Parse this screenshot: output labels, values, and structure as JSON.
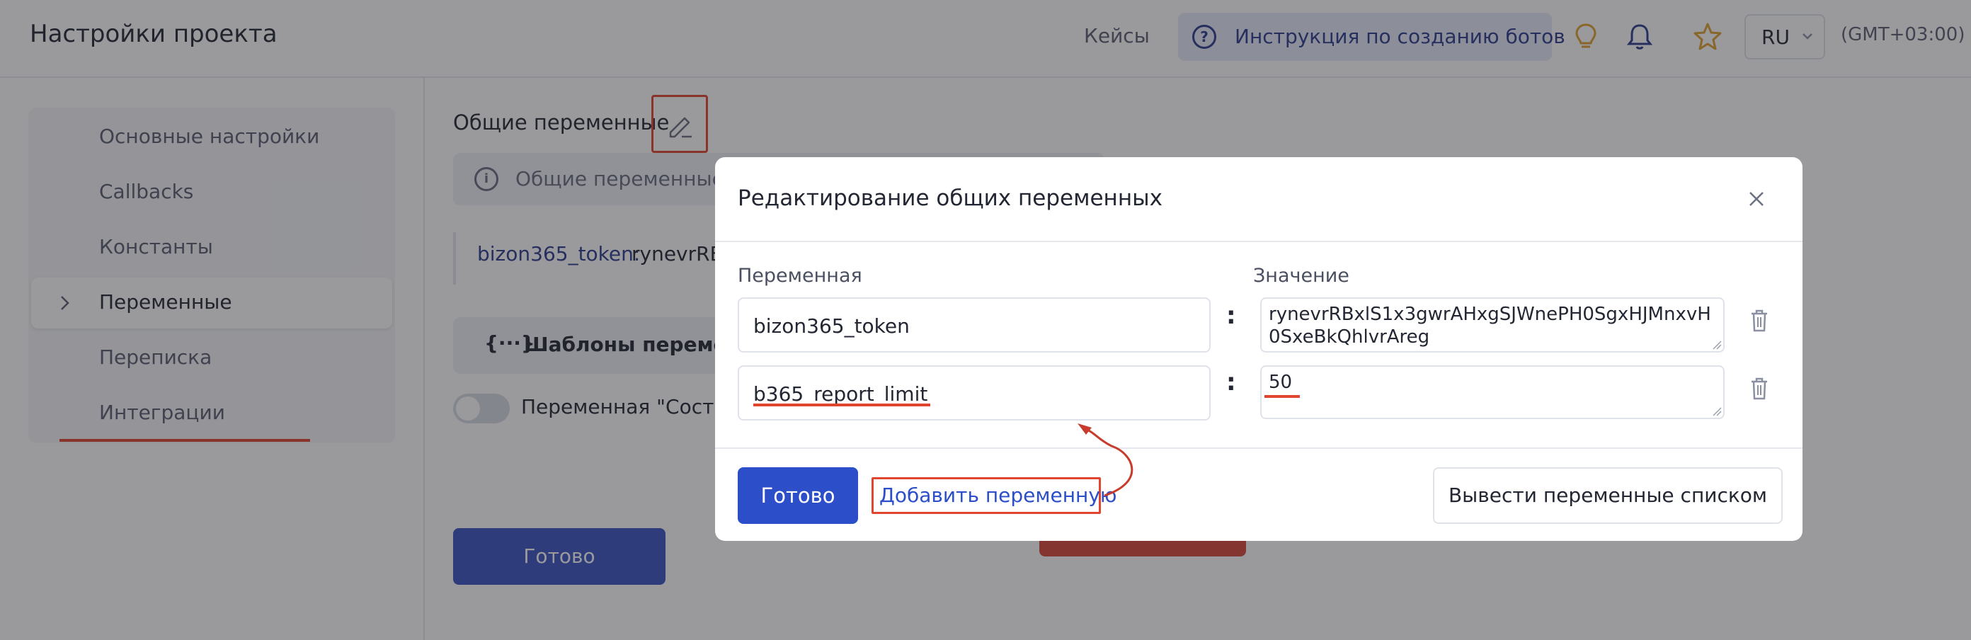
{
  "header": {
    "title": "Настройки проекта",
    "cases_link": "Кейсы",
    "help_button": "Инструкция по созданию ботов",
    "icons": [
      "lightbulb-icon",
      "bell-icon",
      "star-icon"
    ],
    "language": "RU",
    "timezone": "(GMT+03:00)"
  },
  "sidebar": {
    "items": [
      {
        "label": "Основные настройки"
      },
      {
        "label": "Callbacks"
      },
      {
        "label": "Константы"
      },
      {
        "label": "Переменные",
        "active": true
      },
      {
        "label": "Переписка"
      },
      {
        "label": "Интеграции"
      }
    ]
  },
  "main": {
    "section_title": "Общие переменные",
    "info_text": "Общие переменные у",
    "variable": {
      "name": "bizon365_token:",
      "value": "rynevrRB"
    },
    "templates_label": "Шаблоны переменн",
    "toggle_label": "Переменная \"Состоя",
    "done_button": "Готово"
  },
  "modal": {
    "title": "Редактирование общих переменных",
    "col_variable": "Переменная",
    "col_value": "Значение",
    "rows": [
      {
        "name": "bizon365_token",
        "value": "rynevrRBxlS1x3gwrAHxgSJWnePH0SgxHJMnxvH0SxeBkQhlvrAreg"
      },
      {
        "name": "b365_report_limit",
        "value": "50"
      }
    ],
    "separator": ":",
    "done_button": "Готово",
    "add_variable_link": "Добавить переменную",
    "list_button": "Вывести переменные списком"
  },
  "colors": {
    "accent": "#2c4fc9",
    "highlight": "#e0452e",
    "help_bg": "#e5e9f7"
  }
}
